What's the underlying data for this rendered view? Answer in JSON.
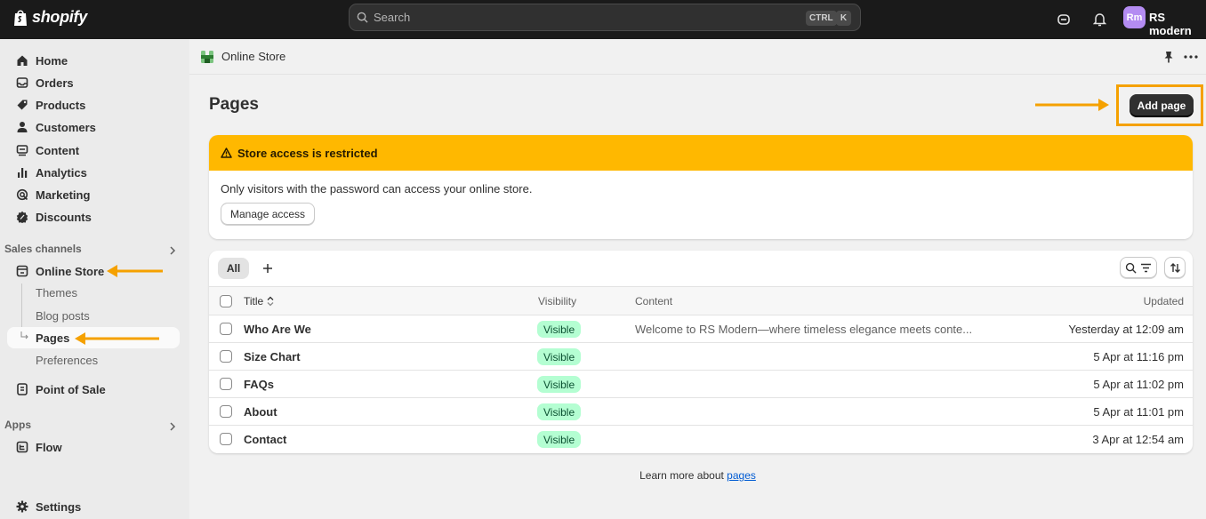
{
  "topbar": {
    "brand": "shopify",
    "search_placeholder": "Search",
    "shortcut_keys": [
      "CTRL",
      "K"
    ],
    "avatar_initials": "Rm",
    "store_name": "RS modern"
  },
  "sidebar": {
    "items": [
      {
        "label": "Home",
        "icon": "home-icon"
      },
      {
        "label": "Orders",
        "icon": "inbox-icon"
      },
      {
        "label": "Products",
        "icon": "tag-icon"
      },
      {
        "label": "Customers",
        "icon": "person-icon"
      },
      {
        "label": "Content",
        "icon": "content-icon"
      },
      {
        "label": "Analytics",
        "icon": "chart-bars-icon"
      },
      {
        "label": "Marketing",
        "icon": "target-icon"
      },
      {
        "label": "Discounts",
        "icon": "discount-icon"
      }
    ],
    "sales_channels_label": "Sales channels",
    "online_store": {
      "label": "Online Store",
      "sub_items": [
        "Themes",
        "Blog posts",
        "Pages",
        "Preferences"
      ],
      "active_sub": "Pages"
    },
    "point_of_sale": "Point of Sale",
    "apps_label": "Apps",
    "flow": "Flow",
    "settings": "Settings"
  },
  "breadcrumb": {
    "label": "Online Store"
  },
  "page": {
    "title": "Pages",
    "add_button": "Add page"
  },
  "banner": {
    "title": "Store access is restricted",
    "text": "Only visitors with the password can access your online store.",
    "button": "Manage access"
  },
  "table": {
    "tab_all": "All",
    "columns": {
      "title": "Title",
      "visibility": "Visibility",
      "content": "Content",
      "updated": "Updated"
    },
    "rows": [
      {
        "title": "Who Are We",
        "visibility": "Visible",
        "content": "Welcome to RS Modern—where timeless elegance meets conte...",
        "updated": "Yesterday at 12:09 am"
      },
      {
        "title": "Size Chart",
        "visibility": "Visible",
        "content": "",
        "updated": "5 Apr at 11:16 pm"
      },
      {
        "title": "FAQs",
        "visibility": "Visible",
        "content": "",
        "updated": "5 Apr at 11:02 pm"
      },
      {
        "title": "About",
        "visibility": "Visible",
        "content": "",
        "updated": "5 Apr at 11:01 pm"
      },
      {
        "title": "Contact",
        "visibility": "Visible",
        "content": "",
        "updated": "3 Apr at 12:54 am"
      }
    ]
  },
  "footer": {
    "text": "Learn more about ",
    "link": "pages"
  },
  "colors": {
    "accent_annotation": "#f5a100",
    "banner": "#ffb800",
    "badge_bg": "#b4fed2"
  }
}
